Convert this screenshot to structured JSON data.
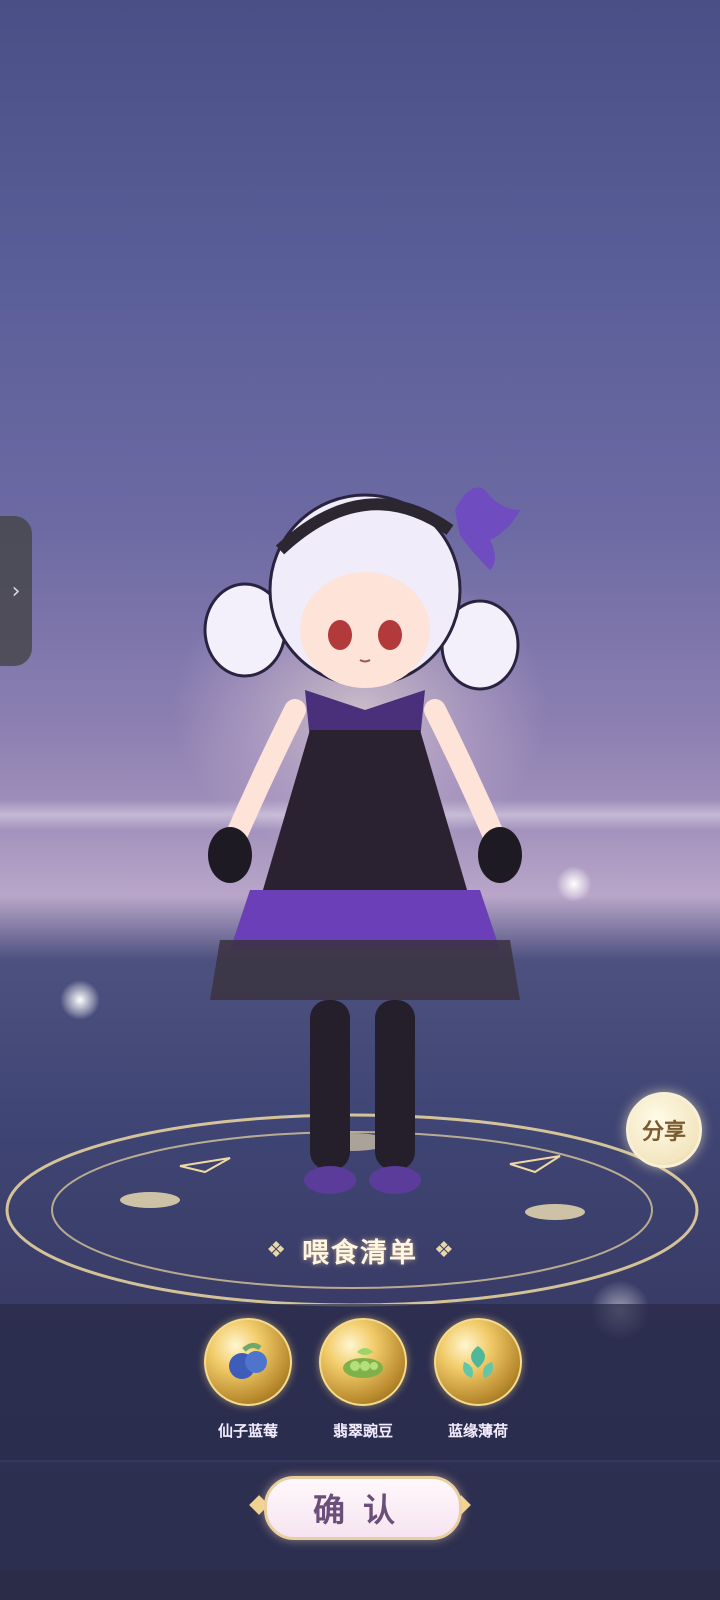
{
  "side_panel": {
    "toggle_icon": "chevron-right-icon",
    "glyph": "›"
  },
  "share": {
    "label": "分享"
  },
  "feeding": {
    "title": "喂食清单",
    "items": [
      {
        "name": "仙子蓝莓",
        "icon": "blueberry-icon"
      },
      {
        "name": "翡翠豌豆",
        "icon": "pea-icon"
      },
      {
        "name": "蓝缘薄荷",
        "icon": "mint-icon"
      }
    ]
  },
  "confirm_label": "确认",
  "colors": {
    "accent_gold": "#e9cfa0",
    "panel_bg": "#2c2e4e"
  }
}
